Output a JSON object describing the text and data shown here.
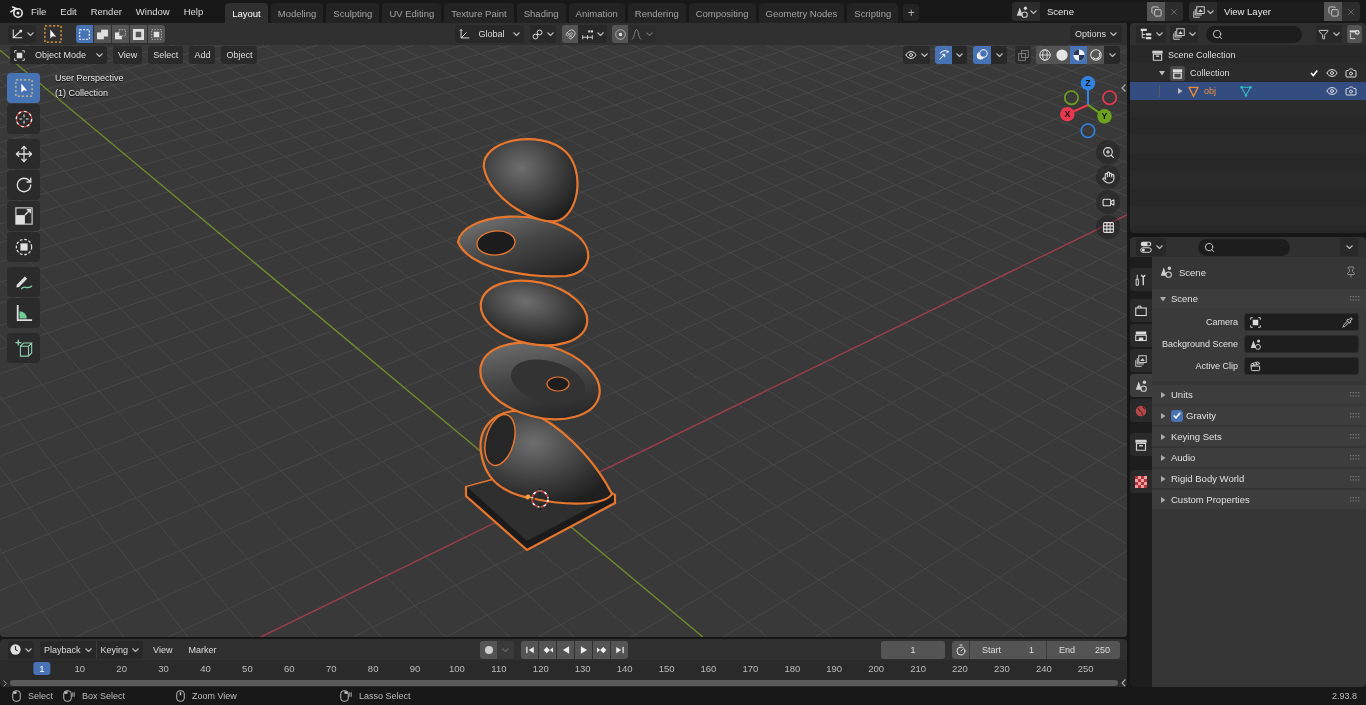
{
  "top_bar": {
    "menus": [
      "File",
      "Edit",
      "Render",
      "Window",
      "Help"
    ],
    "workspaces": [
      {
        "label": "Layout",
        "selected": true
      },
      {
        "label": "Modeling",
        "selected": false
      },
      {
        "label": "Sculpting",
        "selected": false
      },
      {
        "label": "UV Editing",
        "selected": false
      },
      {
        "label": "Texture Paint",
        "selected": false
      },
      {
        "label": "Shading",
        "selected": false
      },
      {
        "label": "Animation",
        "selected": false
      },
      {
        "label": "Rendering",
        "selected": false
      },
      {
        "label": "Compositing",
        "selected": false
      },
      {
        "label": "Geometry Nodes",
        "selected": false
      },
      {
        "label": "Scripting",
        "selected": false
      }
    ],
    "add_workspace": "+",
    "scene": "Scene",
    "view_layer": "View Layer"
  },
  "tool_header": {
    "selection_modes": [
      {
        "kind": "set",
        "selected": true
      },
      {
        "kind": "extend",
        "selected": false
      },
      {
        "kind": "subtract",
        "selected": false
      },
      {
        "kind": "invert",
        "selected": false
      },
      {
        "kind": "intersect",
        "selected": false
      }
    ],
    "orientation": "Global",
    "snap": false,
    "proportional": false,
    "options": "Options"
  },
  "viewport_header": {
    "mode": "Object Mode",
    "menus": [
      "View",
      "Select",
      "Add",
      "Object"
    ],
    "show_gizmo": true,
    "show_overlays": true,
    "xray": false,
    "shading": [
      {
        "kind": "wireframe",
        "selected": false
      },
      {
        "kind": "solid",
        "selected": false
      },
      {
        "kind": "material",
        "selected": true
      },
      {
        "kind": "rendered",
        "selected": false
      }
    ]
  },
  "viewport": {
    "view_name": "User Perspective",
    "collection": "(1) Collection",
    "toolbar": [
      {
        "tools": [
          {
            "kind": "select",
            "selected": true
          },
          {
            "kind": "cursor",
            "selected": false
          }
        ]
      },
      {
        "tools": [
          {
            "kind": "move",
            "selected": false
          },
          {
            "kind": "rotate",
            "selected": false
          },
          {
            "kind": "scale",
            "selected": false
          },
          {
            "kind": "transform",
            "selected": false
          }
        ]
      },
      {
        "tools": [
          {
            "kind": "annotate",
            "selected": false
          },
          {
            "kind": "measure",
            "selected": false
          }
        ]
      },
      {
        "tools": [
          {
            "kind": "add_cube",
            "selected": false
          }
        ]
      }
    ],
    "gizmo_axes": [
      {
        "label": "Z",
        "color": "#2f83e3"
      },
      {
        "label": "X",
        "color": "#e8384f"
      },
      {
        "label": "Y",
        "color": "#6ca11e"
      }
    ]
  },
  "outliner": {
    "tree": [
      {
        "label": "Scene Collection",
        "kind": "scene_collection",
        "selected": false,
        "children": [
          {
            "label": "Collection",
            "kind": "collection",
            "selected": false,
            "expanded": true,
            "checked": true,
            "children": [
              {
                "label": "obj",
                "kind": "object",
                "selected": true,
                "expanded": false
              }
            ]
          }
        ]
      }
    ]
  },
  "properties": {
    "tabs": [
      {
        "kind": "tool",
        "selected": false
      },
      {
        "kind": "render",
        "selected": false
      },
      {
        "kind": "output",
        "selected": false
      },
      {
        "kind": "view_layer",
        "selected": false
      },
      {
        "kind": "scene",
        "selected": true
      },
      {
        "kind": "world",
        "selected": false
      },
      {
        "kind": "collection",
        "selected": false
      },
      {
        "kind": "texture",
        "selected": false
      }
    ],
    "context": "Scene",
    "panels": [
      {
        "title": "Scene",
        "expanded": true,
        "fields": [
          {
            "label": "Camera",
            "kind": "camera"
          },
          {
            "label": "Background Scene",
            "kind": "scene"
          },
          {
            "label": "Active Clip",
            "kind": "clip"
          }
        ]
      },
      {
        "title": "Units",
        "expanded": false
      },
      {
        "title": "Gravity",
        "expanded": false,
        "checked": true
      },
      {
        "title": "Keying Sets",
        "expanded": false
      },
      {
        "title": "Audio",
        "expanded": false
      },
      {
        "title": "Rigid Body World",
        "expanded": false
      },
      {
        "title": "Custom Properties",
        "expanded": false
      }
    ]
  },
  "timeline": {
    "menus": [
      {
        "label": "Playback",
        "kind": "dropdown"
      },
      {
        "label": "Keying",
        "kind": "dropdown"
      },
      {
        "label": "View",
        "kind": "menu"
      },
      {
        "label": "Marker",
        "kind": "menu"
      }
    ],
    "auto_keying": false,
    "current_frame": "1",
    "start_label": "Start",
    "start": "1",
    "end_label": "End",
    "end": "250",
    "ruler": [
      {
        "label": "1",
        "selected": true
      },
      {
        "label": "10",
        "selected": false
      },
      {
        "label": "20",
        "selected": false
      },
      {
        "label": "30",
        "selected": false
      },
      {
        "label": "40",
        "selected": false
      },
      {
        "label": "50",
        "selected": false
      },
      {
        "label": "60",
        "selected": false
      },
      {
        "label": "70",
        "selected": false
      },
      {
        "label": "80",
        "selected": false
      },
      {
        "label": "90",
        "selected": false
      },
      {
        "label": "100",
        "selected": false
      },
      {
        "label": "110",
        "selected": false
      },
      {
        "label": "120",
        "selected": false
      },
      {
        "label": "130",
        "selected": false
      },
      {
        "label": "140",
        "selected": false
      },
      {
        "label": "150",
        "selected": false
      },
      {
        "label": "160",
        "selected": false
      },
      {
        "label": "170",
        "selected": false
      },
      {
        "label": "180",
        "selected": false
      },
      {
        "label": "190",
        "selected": false
      },
      {
        "label": "200",
        "selected": false
      },
      {
        "label": "210",
        "selected": false
      },
      {
        "label": "220",
        "selected": false
      },
      {
        "label": "230",
        "selected": false
      },
      {
        "label": "240",
        "selected": false
      },
      {
        "label": "250",
        "selected": false
      }
    ]
  },
  "status_bar": {
    "hints": [
      {
        "label": "Select",
        "kind": "click"
      },
      {
        "label": "Box Select",
        "kind": "drag"
      },
      {
        "label": "Zoom View",
        "kind": "middle"
      },
      {
        "label": "Lasso Select",
        "kind": "right_drag"
      }
    ],
    "version": "2.93.8"
  }
}
